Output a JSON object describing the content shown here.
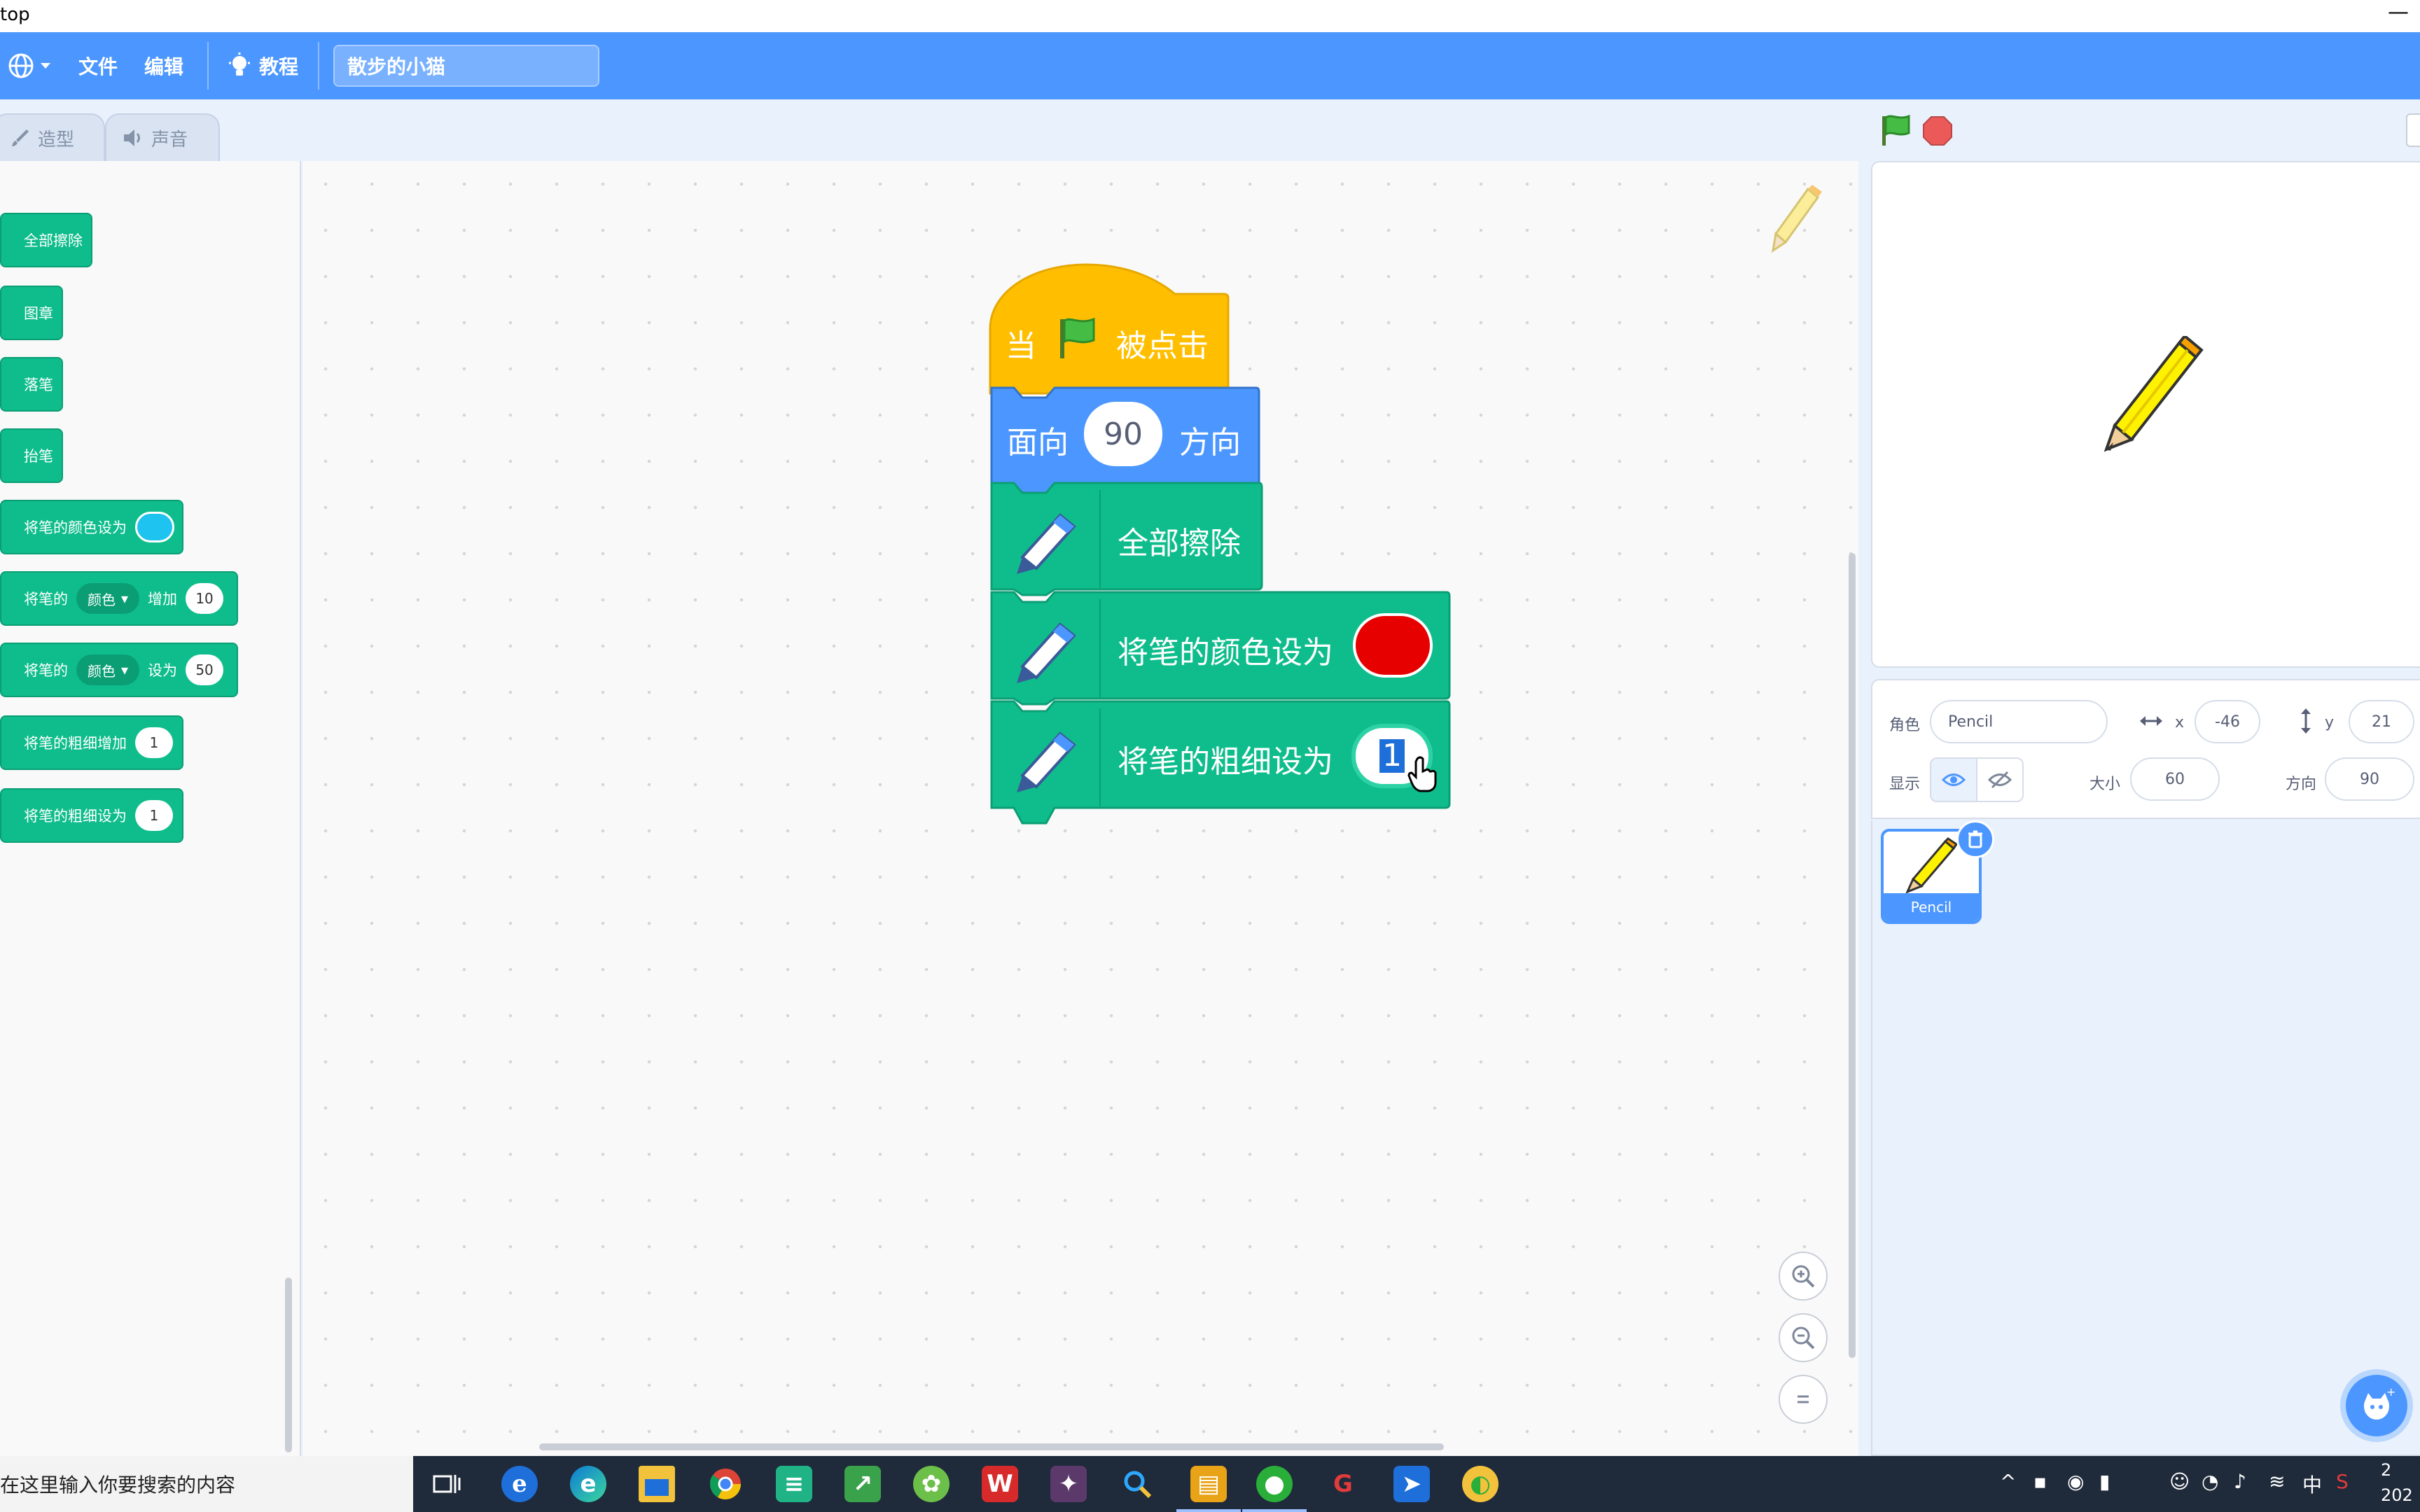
{
  "window": {
    "title": "top",
    "minimize": "—"
  },
  "menubar": {
    "file": "文件",
    "edit": "编辑",
    "tutorial": "教程",
    "project_title": "散步的小猫"
  },
  "tabs": {
    "costumes": "造型",
    "sounds": "声音"
  },
  "palette": {
    "clear": "全部擦除",
    "stamp": "图章",
    "pen_down": "落笔",
    "pen_up": "抬笔",
    "set_color_to": "将笔的颜色设为",
    "change_prefix": "将笔的",
    "change_dropdown": "颜色",
    "change_suffix": "增加",
    "change_value": "10",
    "set_prefix": "将笔的",
    "set_dropdown": "颜色",
    "set_suffix": "设为",
    "set_value": "50",
    "change_size": "将笔的粗细增加",
    "change_size_value": "1",
    "set_size": "将笔的粗细设为",
    "set_size_value": "1",
    "swatch_color": "#1ec3f0"
  },
  "script": {
    "hat_when": "当",
    "hat_clicked": "被点击",
    "point_label": "面向",
    "point_value": "90",
    "point_suffix": "方向",
    "clear_label": "全部擦除",
    "color_label": "将笔的颜色设为",
    "color_value": "#e60000",
    "size_label": "将笔的粗细设为",
    "size_value": "1"
  },
  "sprite_info": {
    "sprite_label": "角色",
    "sprite_name": "Pencil",
    "x_label": "x",
    "x_value": "-46",
    "y_label": "y",
    "y_value": "21",
    "show_label": "显示",
    "size_label": "大小",
    "size_value": "60",
    "direction_label": "方向",
    "direction_value": "90"
  },
  "sprite_list": [
    {
      "name": "Pencil"
    }
  ],
  "taskbar": {
    "search_placeholder": "在这里输入你要搜索的内容",
    "ime": "中",
    "clock_time": "2",
    "clock_date": "202"
  },
  "colors": {
    "menu_blue": "#4c97ff",
    "pen_green": "#0fbd8c",
    "events_yellow": "#ffbf00",
    "motion_blue": "#4c97ff"
  }
}
